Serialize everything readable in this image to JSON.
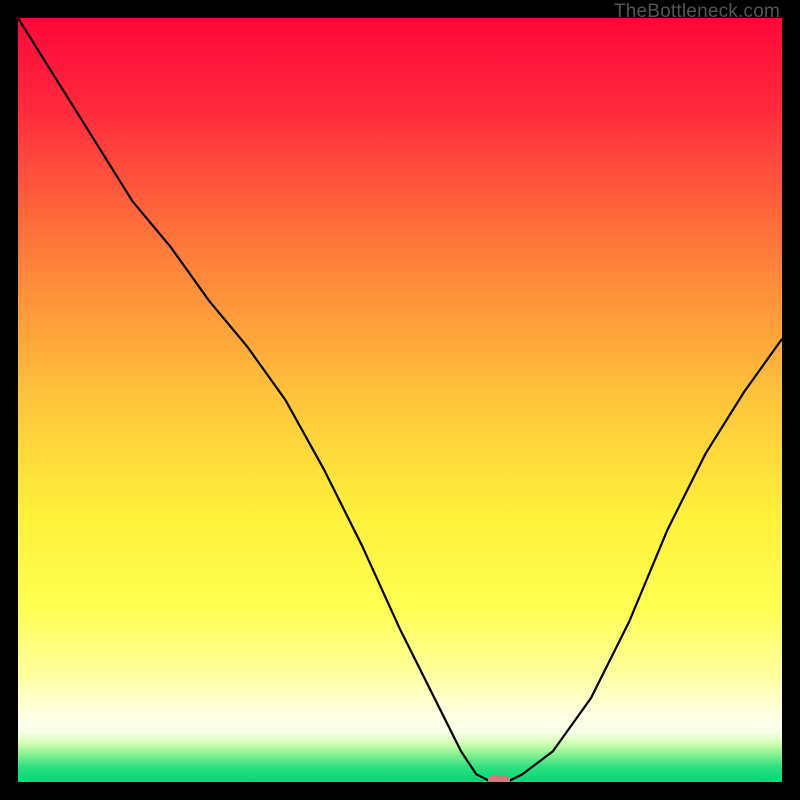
{
  "watermark": "TheBottleneck.com",
  "chart_data": {
    "type": "line",
    "title": "",
    "xlabel": "",
    "ylabel": "",
    "xlim": [
      0,
      100
    ],
    "ylim": [
      0,
      100
    ],
    "x": [
      0,
      5,
      10,
      15,
      20,
      25,
      30,
      35,
      40,
      45,
      50,
      55,
      58,
      60,
      62,
      64,
      66,
      70,
      75,
      80,
      85,
      90,
      95,
      100
    ],
    "values": [
      100,
      92,
      84,
      76,
      70,
      63,
      57,
      50,
      41,
      31,
      20,
      10,
      4,
      1,
      0,
      0,
      1,
      4,
      11,
      21,
      33,
      43,
      51,
      58
    ],
    "marker": {
      "x": 63,
      "y": 0
    }
  },
  "colors": {
    "top": "#ff073a",
    "mid1": "#ff6a3a",
    "mid2": "#ffd53a",
    "mid3": "#ffff4a",
    "light": "#ffffd0",
    "green": "#00e676",
    "marker": "#d07a7a"
  }
}
